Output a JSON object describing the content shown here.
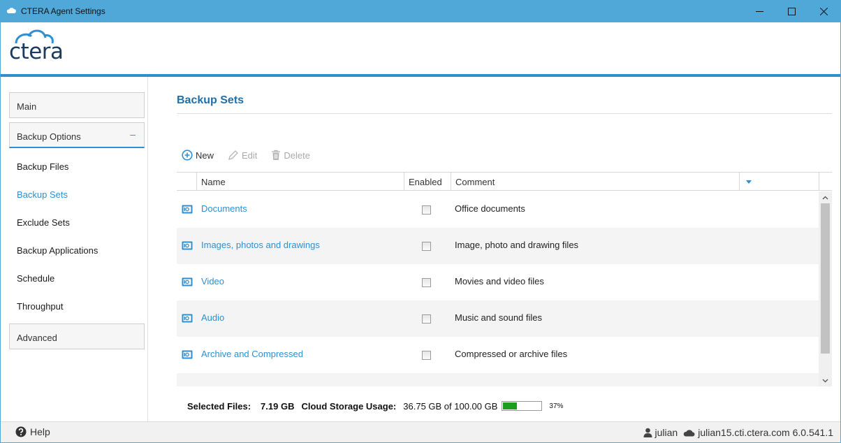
{
  "window": {
    "title": "CTERA Agent Settings"
  },
  "brand": {
    "logo_text": "ctera",
    "accent": "#2f8fd0",
    "titlebar": "#4fa8d8"
  },
  "sidebar": {
    "main_label": "Main",
    "backup_options_label": "Backup Options",
    "collapse_symbol": "–",
    "items": [
      {
        "label": "Backup Files"
      },
      {
        "label": "Backup Sets"
      },
      {
        "label": "Exclude Sets"
      },
      {
        "label": "Backup Applications"
      },
      {
        "label": "Schedule"
      },
      {
        "label": "Throughput"
      }
    ],
    "advanced_label": "Advanced"
  },
  "page": {
    "title": "Backup Sets"
  },
  "toolbar": {
    "new_label": "New",
    "edit_label": "Edit",
    "delete_label": "Delete"
  },
  "table": {
    "columns": {
      "name": "Name",
      "enabled": "Enabled",
      "comment": "Comment"
    },
    "rows": [
      {
        "name": "Documents",
        "enabled": false,
        "comment": "Office documents"
      },
      {
        "name": "Images, photos and drawings",
        "enabled": false,
        "comment": "Image, photo and drawing files"
      },
      {
        "name": "Video",
        "enabled": false,
        "comment": "Movies and video files"
      },
      {
        "name": "Audio",
        "enabled": false,
        "comment": "Music and sound files"
      },
      {
        "name": "Archive and Compressed",
        "enabled": false,
        "comment": "Compressed or archive files"
      }
    ]
  },
  "stats": {
    "selected_files_label": "Selected Files:",
    "selected_files_value": "7.19 GB",
    "cloud_usage_label": "Cloud Storage Usage:",
    "cloud_usage_value": "36.75 GB of 100.00 GB",
    "usage_percent_text": "37%",
    "usage_fraction": 0.37
  },
  "footer": {
    "help_label": "Help",
    "user": "julian",
    "server": "julian15.cti.ctera.com 6.0.541.1"
  }
}
